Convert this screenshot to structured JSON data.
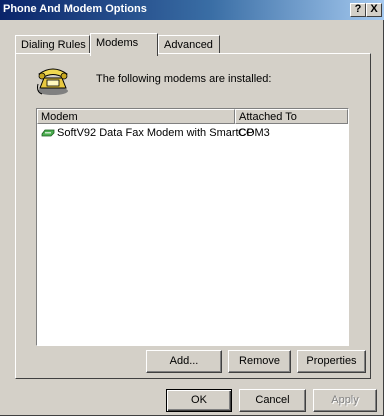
{
  "window": {
    "title": "Phone And Modem Options",
    "help_button": "?",
    "close_button": "X"
  },
  "tabs": [
    {
      "label": "Dialing Rules",
      "active": false
    },
    {
      "label": "Modems",
      "active": true
    },
    {
      "label": "Advanced",
      "active": false
    }
  ],
  "panel": {
    "intro_text": "The following modems are  installed:",
    "icon": "phone-modem-icon"
  },
  "modem_list": {
    "columns": [
      "Modem",
      "Attached To"
    ],
    "rows": [
      {
        "modem": "SoftV92 Data Fax Modem with SmartCP",
        "attached_to": "COM3",
        "icon": "modem-icon"
      }
    ]
  },
  "panel_buttons": {
    "add": "Add...",
    "remove": "Remove",
    "properties": "Properties"
  },
  "dialog_buttons": {
    "ok": "OK",
    "cancel": "Cancel",
    "apply": "Apply",
    "apply_disabled": true
  },
  "colors": {
    "title_bar_start": "#0a246a",
    "title_bar_end": "#a6caf0",
    "face": "#d4d0c8"
  }
}
